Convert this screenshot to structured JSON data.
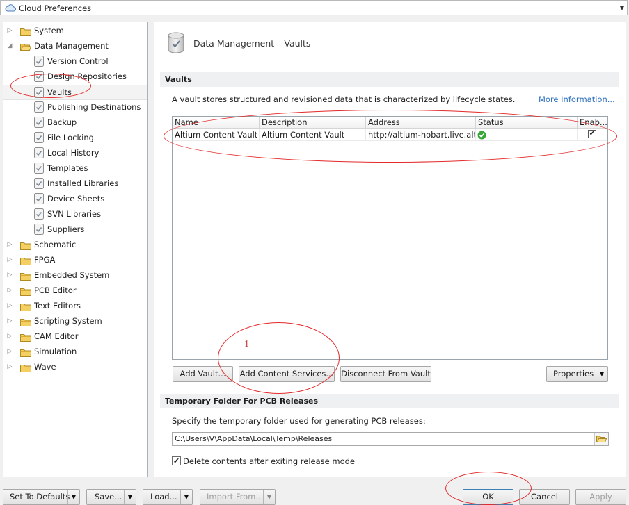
{
  "window": {
    "title": "Cloud Preferences"
  },
  "tree": {
    "top": [
      {
        "label": "System"
      },
      {
        "label": "Data Management"
      }
    ],
    "children": [
      {
        "label": "Version Control"
      },
      {
        "label": "Design Repositories"
      },
      {
        "label": "Vaults"
      },
      {
        "label": "Publishing Destinations"
      },
      {
        "label": "Backup"
      },
      {
        "label": "File Locking"
      },
      {
        "label": "Local History"
      },
      {
        "label": "Templates"
      },
      {
        "label": "Installed Libraries"
      },
      {
        "label": "Device Sheets"
      },
      {
        "label": "SVN Libraries"
      },
      {
        "label": "Suppliers"
      }
    ],
    "rest": [
      {
        "label": "Schematic"
      },
      {
        "label": "FPGA"
      },
      {
        "label": "Embedded System"
      },
      {
        "label": "PCB Editor"
      },
      {
        "label": "Text Editors"
      },
      {
        "label": "Scripting System"
      },
      {
        "label": "CAM Editor"
      },
      {
        "label": "Simulation"
      },
      {
        "label": "Wave"
      }
    ]
  },
  "page": {
    "title": "Data Management – Vaults"
  },
  "vaults": {
    "header": "Vaults",
    "description": "A vault stores structured and revisioned data that is characterized by lifecycle states.",
    "more_info": "More Information...",
    "columns": [
      "Name",
      "Description",
      "Address",
      "Status",
      "Enab..."
    ],
    "rows": [
      {
        "name": "Altium Content Vault",
        "description": "Altium Content Vault",
        "address": "http://altium-hobart.live.alti...",
        "status": "ok",
        "enabled": true
      }
    ],
    "buttons": {
      "add_vault": "Add Vault...",
      "add_content_services": "Add Content Services...",
      "disconnect": "Disconnect From Vault",
      "properties": "Properties"
    }
  },
  "temp": {
    "header": "Temporary Folder For PCB Releases",
    "description": "Specify the temporary folder used for generating PCB releases:",
    "path": "C:\\Users\\V\\AppData\\Local\\Temp\\Releases",
    "delete_label": "Delete contents after exiting release mode",
    "delete_checked": true
  },
  "footer": {
    "set_defaults": "Set To Defaults",
    "save": "Save...",
    "load": "Load...",
    "import_from": "Import From...",
    "ok": "OK",
    "cancel": "Cancel",
    "apply": "Apply"
  },
  "annotation": {
    "number": "1"
  },
  "colors": {
    "annotation": "#e32b2b",
    "link": "#2c6fbf",
    "status_ok": "#3aa63a"
  }
}
